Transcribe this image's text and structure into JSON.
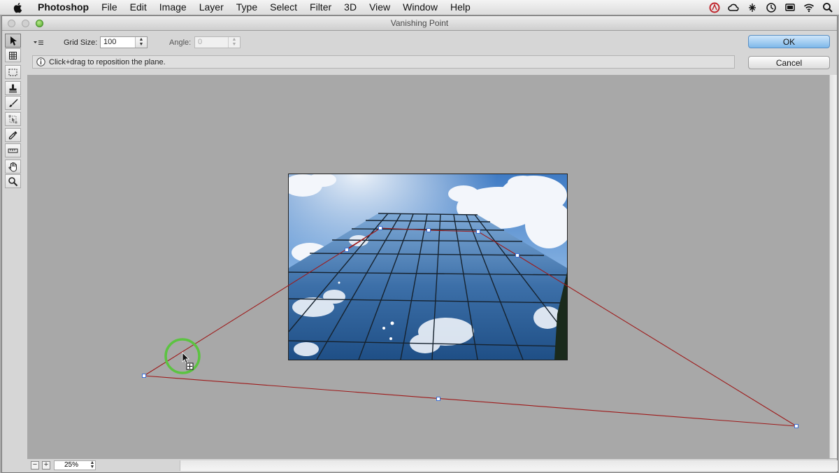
{
  "menubar": {
    "app": "Photoshop",
    "items": [
      "File",
      "Edit",
      "Image",
      "Layer",
      "Type",
      "Select",
      "Filter",
      "3D",
      "View",
      "Window",
      "Help"
    ]
  },
  "window": {
    "title": "Vanishing Point"
  },
  "tools": [
    "edit-plane",
    "create-plane",
    "marquee",
    "stamp",
    "brush",
    "transform",
    "eyedropper",
    "measure",
    "hand",
    "zoom"
  ],
  "options": {
    "grid_size_label": "Grid Size:",
    "grid_size_value": "100",
    "angle_label": "Angle:",
    "angle_value": "0"
  },
  "hint": {
    "text": "Click+drag to reposition the plane."
  },
  "buttons": {
    "ok": "OK",
    "cancel": "Cancel"
  },
  "status": {
    "zoom": "25%"
  },
  "colors": {
    "plane_line": "#9e1a1a",
    "handle": "#3b6fd4",
    "cursor_ring": "#5cc341",
    "ok_button": "#7eb8ea"
  }
}
